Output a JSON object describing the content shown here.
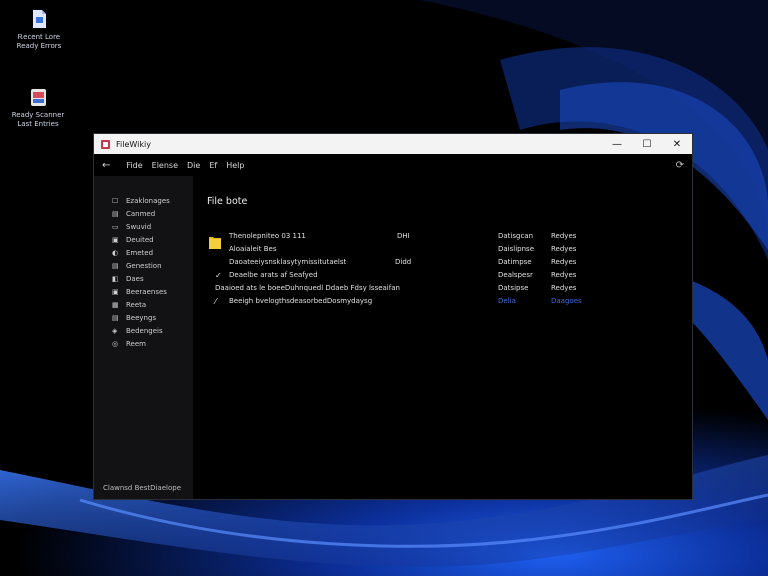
{
  "desktop": {
    "icons": [
      {
        "label_line1": "Ꭱecent Lore",
        "label_line2": "Ready Errors",
        "icon": "file-icon"
      },
      {
        "label_line1": "Ready Scanner",
        "label_line2": "Last Entries",
        "icon": "scanner-app-icon"
      }
    ]
  },
  "window": {
    "title": "FileWikiy",
    "controls": {
      "minimize": "—",
      "maximize": "☐",
      "close": "✕"
    },
    "menu": {
      "back": "←",
      "items": [
        "Fide",
        "Elense",
        "Die",
        "Ef",
        "Help"
      ],
      "settings": "⟳"
    },
    "sidebar": {
      "items": [
        {
          "label": "Ezaklonages",
          "icon": "☐"
        },
        {
          "label": "Canmed",
          "icon": "▤"
        },
        {
          "label": "Swuvid",
          "icon": "▭"
        },
        {
          "label": "Deuited",
          "icon": "▣"
        },
        {
          "label": "Emeted",
          "icon": "◐"
        },
        {
          "label": "Genestion",
          "icon": "▤"
        },
        {
          "label": "Daes",
          "icon": "◧"
        },
        {
          "label": "Beeraenses",
          "icon": "▣"
        },
        {
          "label": "Reeta",
          "icon": "▦"
        },
        {
          "label": "Beeyngs",
          "icon": "▤"
        },
        {
          "label": "Bedengeis",
          "icon": "◈"
        },
        {
          "label": "Reem",
          "icon": "◎"
        }
      ],
      "footer": "Clawnsd BestDiaelope"
    },
    "main": {
      "heading": "File bote",
      "rows": [
        {
          "check": "",
          "name": "Thenolepniteo 03 111",
          "size": "",
          "extra": "DHI",
          "type": "Datisgcan",
          "status": "Redyes",
          "link": false
        },
        {
          "check": "",
          "name": "Aloaialeit Bes",
          "size": "",
          "extra": "",
          "type": "Daislipnse",
          "status": "Redyes",
          "link": false
        },
        {
          "check": "",
          "name": "Daoateeiysnsklasytymissitutaelst",
          "size": "Didd",
          "extra": "",
          "type": "Datimpse",
          "status": "Redyes",
          "link": false
        },
        {
          "check": "✓",
          "name": "Deaelbe arats af Seafyed",
          "size": "",
          "extra": "",
          "type": "Dealspesr",
          "status": "Redyes",
          "link": false
        },
        {
          "check": "",
          "name": "Daaioed ats le boeeDuhnquedl Ddaeb Fdsy lsseaifan",
          "size": "",
          "extra": "",
          "type": "Datsipse",
          "status": "Redyes",
          "link": false
        },
        {
          "check": "⁄",
          "name": "Beeigh bvelogthsdeasorbedDosmydaysg",
          "size": "",
          "extra": "",
          "type": "Delia",
          "status": "Daagoes",
          "link": true
        }
      ]
    }
  },
  "colors": {
    "accent": "#3d6bdc",
    "titlebar": "#f3f3f3",
    "sidebar": "#121214"
  }
}
